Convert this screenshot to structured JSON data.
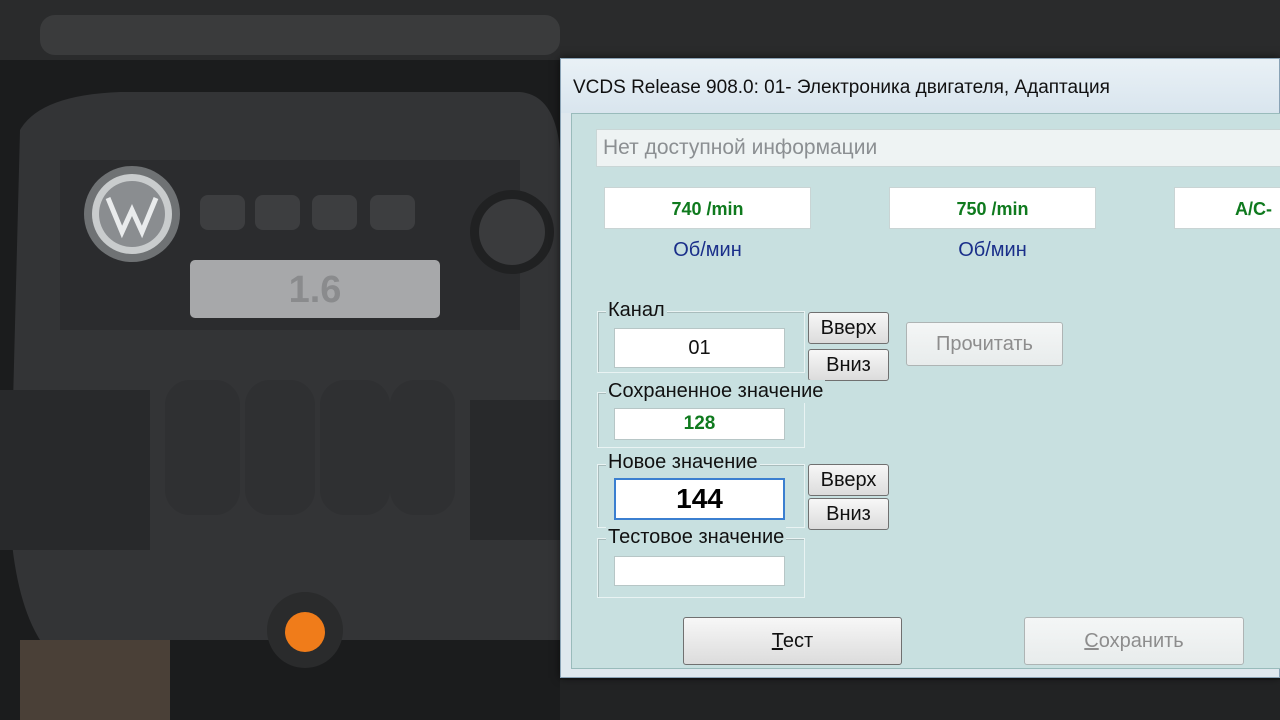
{
  "window": {
    "title": "VCDS Release 908.0: 01- Электроника двигателя,  Адаптация"
  },
  "info_bar": {
    "text": "Нет доступной информации"
  },
  "measurements": [
    {
      "value": "740 /min",
      "unit": "Об/мин"
    },
    {
      "value": "750 /min",
      "unit": "Об/мин"
    },
    {
      "value": "A/C-"
    }
  ],
  "channel": {
    "label": "Канал",
    "value": "01",
    "up_label": "Вверх",
    "down_label": "Вниз"
  },
  "read_button": {
    "label": "Прочитать",
    "enabled": false
  },
  "saved_value": {
    "label": "Сохраненное значение",
    "value": "128"
  },
  "new_value": {
    "label": "Новое значение",
    "value": "144",
    "up_label": "Вверх",
    "down_label": "Вниз"
  },
  "test_value": {
    "label": "Тестовое значение",
    "value": ""
  },
  "buttons": {
    "test": {
      "hotkey": "Т",
      "rest": "ест"
    },
    "save": {
      "hotkey": "С",
      "rest": "охранить",
      "enabled": false
    }
  },
  "background": {
    "engine_badge": "1.6"
  },
  "colors": {
    "value_green": "#0f7a1e",
    "unit_blue": "#1a2f8a",
    "panel_bg": "#c8e0e0"
  }
}
